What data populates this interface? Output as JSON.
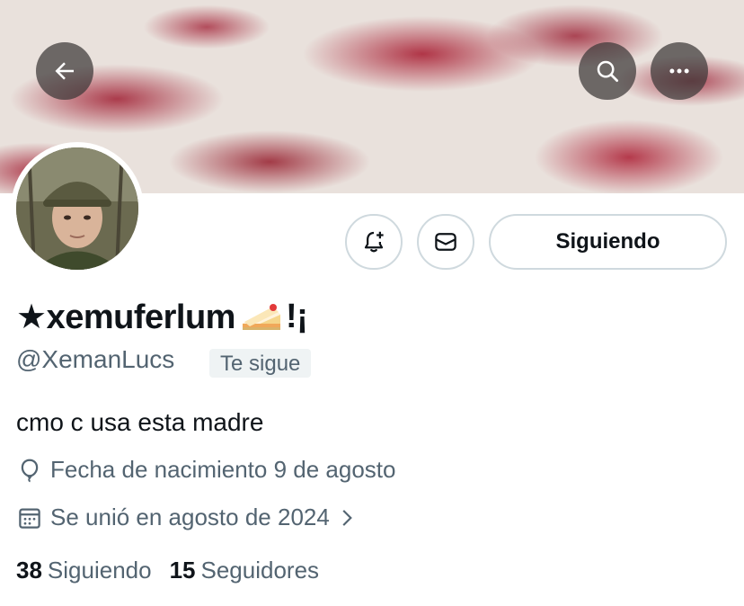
{
  "profile": {
    "display_name": "★xemuferlum",
    "display_name_suffix": "!¡",
    "name_emoji": "cake-emoji",
    "handle": "@XemanLucs",
    "follows_you_badge": "Te sigue",
    "bio": "cmo c usa esta madre",
    "birthday": "Fecha de nacimiento 9 de agosto",
    "joined": "Se unió en agosto de 2024",
    "following_count": "38",
    "following_label": "Siguiendo",
    "followers_count": "15",
    "followers_label": "Seguidores"
  },
  "actions": {
    "follow_state_label": "Siguiendo",
    "notify_icon": "bell-plus-icon",
    "message_icon": "envelope-icon"
  },
  "header": {
    "back_icon": "back-arrow-icon",
    "search_icon": "search-icon",
    "more_icon": "more-icon"
  },
  "colors": {
    "text": "#0f1419",
    "muted": "#536471",
    "border": "#cfd9de",
    "badge_bg": "#eff3f4",
    "banner_red": "#a6233c"
  }
}
